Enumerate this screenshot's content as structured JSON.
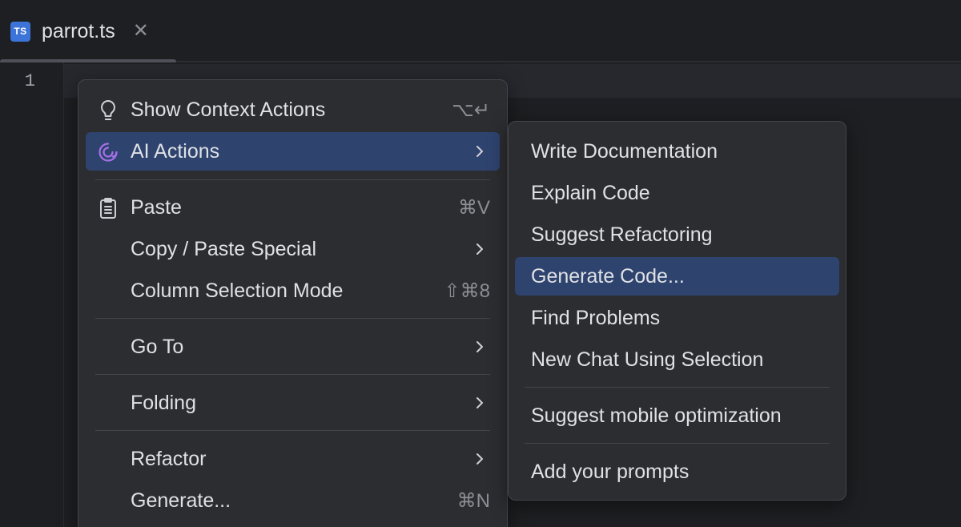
{
  "tab": {
    "file_type_badge": "TS",
    "title": "parrot.ts",
    "close_glyph": "✕"
  },
  "editor": {
    "line_number": "1"
  },
  "context_menu": {
    "items": [
      {
        "label": "Show Context Actions",
        "shortcut": "⌥↵",
        "icon": "lightbulb-icon"
      },
      {
        "label": "AI Actions",
        "has_submenu": true,
        "icon": "ai-assistant-icon",
        "selected": true
      },
      {
        "label": "Paste",
        "shortcut": "⌘V",
        "icon": "clipboard-icon"
      },
      {
        "label": "Copy / Paste Special",
        "has_submenu": true
      },
      {
        "label": "Column Selection Mode",
        "shortcut": "⇧⌘8"
      },
      {
        "label": "Go To",
        "has_submenu": true
      },
      {
        "label": "Folding",
        "has_submenu": true
      },
      {
        "label": "Refactor",
        "has_submenu": true
      },
      {
        "label": "Generate...",
        "shortcut": "⌘N"
      }
    ]
  },
  "ai_submenu": {
    "items": [
      {
        "label": "Write Documentation"
      },
      {
        "label": "Explain Code"
      },
      {
        "label": "Suggest Refactoring"
      },
      {
        "label": "Generate Code...",
        "selected": true
      },
      {
        "label": "Find Problems"
      },
      {
        "label": "New Chat Using Selection"
      },
      {
        "label": "Suggest mobile optimization"
      },
      {
        "label": "Add your prompts"
      }
    ]
  },
  "colors": {
    "background": "#1e1f22",
    "menu_background": "#2b2d30",
    "selection": "#2e436e",
    "ts_badge": "#3d74d9",
    "ai_icon": "#a571e6"
  }
}
